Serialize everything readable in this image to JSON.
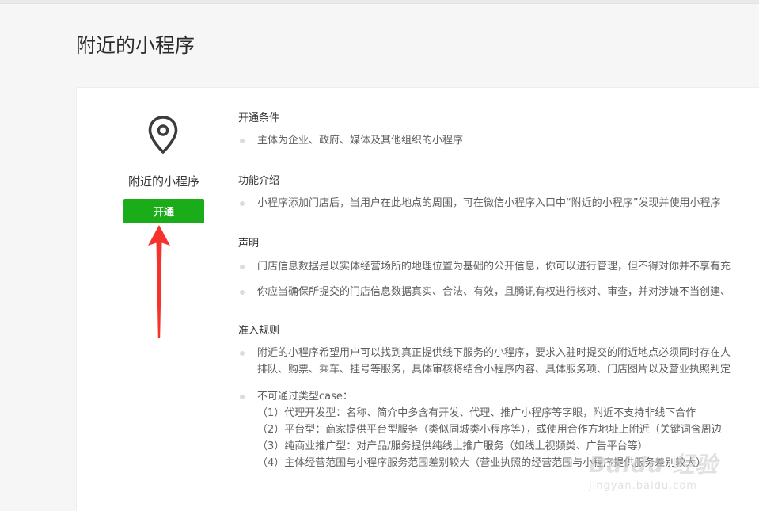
{
  "page": {
    "title": "附近的小程序"
  },
  "sidebar": {
    "app_name": "附近的小程序",
    "open_label": "开通"
  },
  "sections": [
    {
      "title": "开通条件",
      "items": [
        {
          "lines": [
            "主体为企业、政府、媒体及其他组织的小程序"
          ]
        }
      ]
    },
    {
      "title": "功能介绍",
      "items": [
        {
          "lines": [
            "小程序添加门店后，当用户在此地点的周围，可在微信小程序入口中“附近的小程序”发现并使用小程序"
          ]
        }
      ]
    },
    {
      "title": "声明",
      "items": [
        {
          "lines": [
            "门店信息数据是以实体经营场所的地理位置为基础的公开信息，你可以进行管理，但不得对你并不享有充"
          ]
        },
        {
          "lines": [
            "你应当确保所提交的门店信息数据真实、合法、有效，且腾讯有权进行核对、审查，并对涉嫌不当创建、"
          ]
        }
      ]
    },
    {
      "title": "准入规则",
      "items": [
        {
          "lines": [
            "附近的小程序希望用户可以找到真正提供线下服务的小程序，要求入驻时提交的附近地点必须同时存在人",
            "排队、购票、乘车、挂号等服务，具体审核将结合小程序内容、具体服务项、门店图片以及营业执照判定"
          ]
        },
        {
          "lines": [
            "不可通过类型case：",
            "（1）代理开发型：名称、简介中多含有开发、代理、推广小程序等字眼，附近不支持非线下合作",
            "（2）平台型：商家提供平台型服务（类似同城类小程序等），或使用合作方地址上附近（关键词含周边",
            "（3）纯商业推广型：对产品/服务提供纯线上推广服务（如线上视频类、广告平台等）",
            "（4）主体经营范围与小程序服务范围差别较大（营业执照的经营范围与小程序提供服务差别较大）"
          ]
        }
      ]
    }
  ],
  "watermark": {
    "logo": "Baidu 经验",
    "url": "jingyan.baidu.com"
  },
  "colors": {
    "accent_green": "#1aad19",
    "arrow_red": "#f5322b"
  },
  "icons": {
    "location": "location-pin-icon",
    "annotation": "red-arrow-icon"
  }
}
